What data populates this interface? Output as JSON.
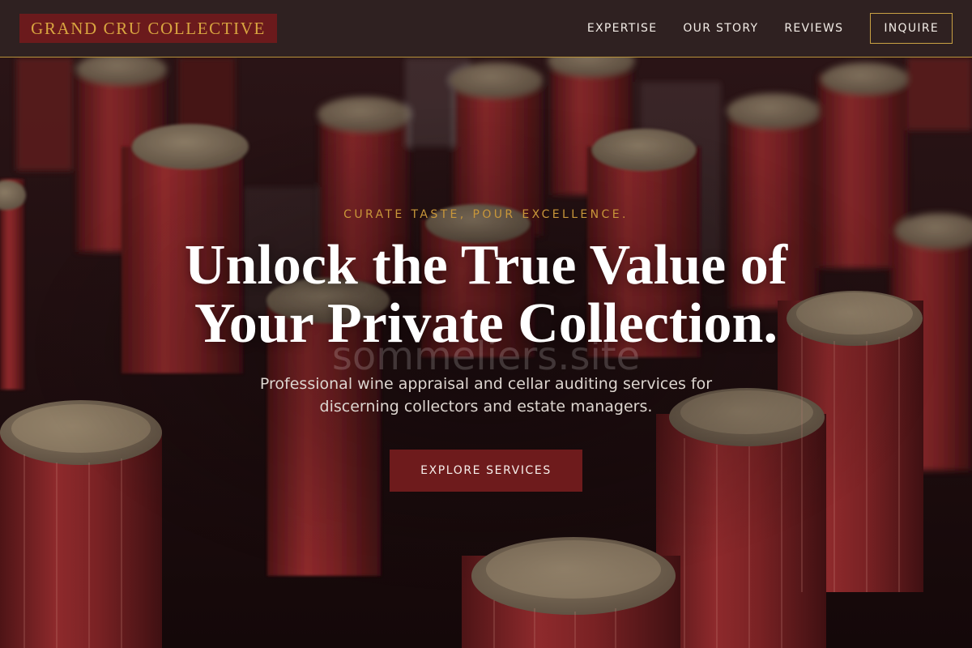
{
  "brand": {
    "name": "GRAND CRU COLLECTIVE"
  },
  "nav": {
    "links": [
      {
        "label": "EXPERTISE"
      },
      {
        "label": "OUR STORY"
      },
      {
        "label": "REVIEWS"
      }
    ],
    "cta_label": "INQUIRE"
  },
  "hero": {
    "eyebrow": "CURATE TASTE, POUR EXCELLENCE.",
    "headline_line1": "Unlock the True Value of",
    "headline_line2": "Your Private Collection.",
    "watermark": "sommeliers.site",
    "subtitle_line1": "Professional wine appraisal and cellar auditing services for",
    "subtitle_line2": "discerning collectors and estate managers.",
    "button_label": "EXPLORE SERVICES",
    "background_image": "wine-bottle-tops-photo"
  },
  "colors": {
    "header_bg": "#2f2121",
    "accent_gold": "#d9a640",
    "brand_burgundy": "#6b1a1c",
    "button_bg": "#6e1b1c"
  }
}
